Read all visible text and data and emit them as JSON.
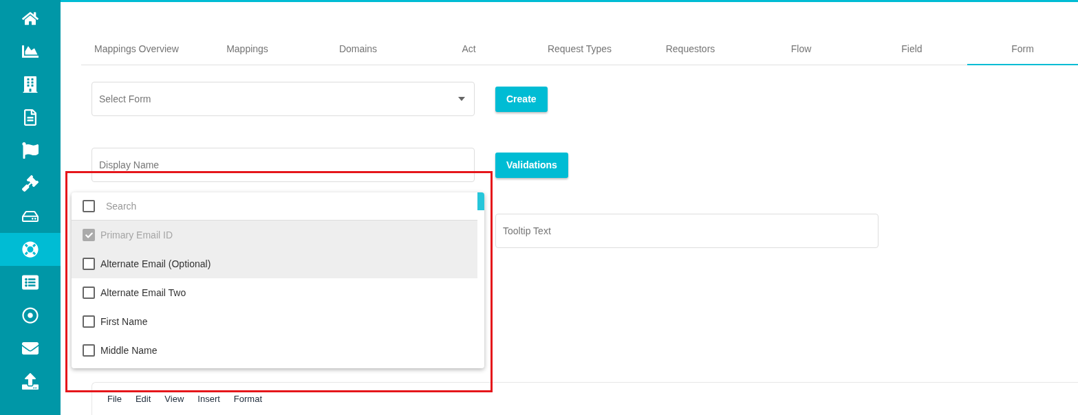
{
  "sidebar": {
    "items": [
      {
        "selected": false
      },
      {
        "selected": false
      },
      {
        "selected": false
      },
      {
        "selected": false
      },
      {
        "selected": false
      },
      {
        "selected": false
      },
      {
        "selected": false
      },
      {
        "selected": true
      },
      {
        "selected": false
      },
      {
        "selected": false
      },
      {
        "selected": false
      },
      {
        "selected": false
      }
    ]
  },
  "tabs": [
    {
      "label": "Mappings Overview",
      "selected": false
    },
    {
      "label": "Mappings",
      "selected": false
    },
    {
      "label": "Domains",
      "selected": false
    },
    {
      "label": "Act",
      "selected": false
    },
    {
      "label": "Request Types",
      "selected": false
    },
    {
      "label": "Requestors",
      "selected": false
    },
    {
      "label": "Flow",
      "selected": false
    },
    {
      "label": "Field",
      "selected": false
    },
    {
      "label": "Form",
      "selected": true
    }
  ],
  "form_select": {
    "placeholder": "Select Form"
  },
  "create_button": "Create",
  "display_name": {
    "placeholder": "Display Name"
  },
  "validations_button": "Validations",
  "tooltip_text": {
    "placeholder": "Tooltip Text"
  },
  "dropdown": {
    "select_all_checked": false,
    "search": {
      "placeholder": "Search"
    },
    "options": [
      {
        "label": "Primary Email ID",
        "checked": true,
        "disabled": true,
        "highlighted": true
      },
      {
        "label": "Alternate Email (Optional)",
        "checked": false,
        "disabled": false,
        "highlighted": true
      },
      {
        "label": "Alternate Email Two",
        "checked": false,
        "disabled": false,
        "highlighted": false
      },
      {
        "label": "First Name",
        "checked": false,
        "disabled": false,
        "highlighted": false
      },
      {
        "label": "Middle Name",
        "checked": false,
        "disabled": false,
        "highlighted": false
      }
    ]
  },
  "editor": {
    "menu": [
      "File",
      "Edit",
      "View",
      "Insert",
      "Format"
    ]
  }
}
